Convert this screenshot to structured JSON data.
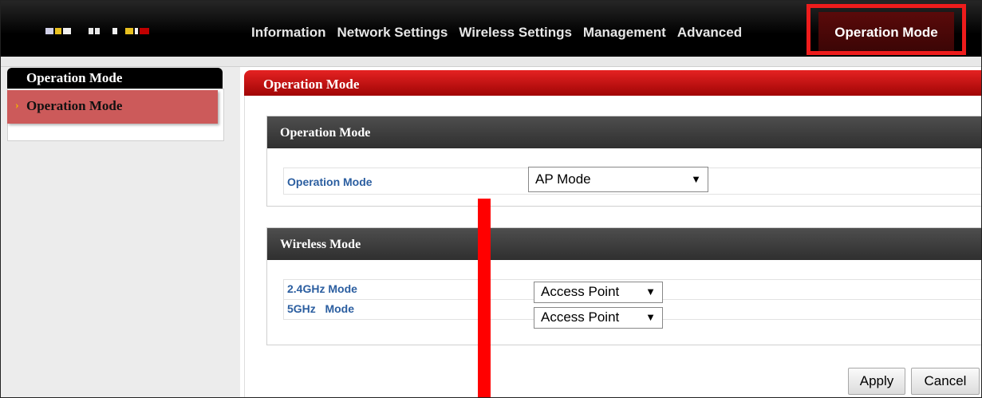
{
  "nav": {
    "items": [
      "Information",
      "Network Settings",
      "Wireless Settings",
      "Management",
      "Advanced"
    ],
    "active": "Operation Mode"
  },
  "sidebar": {
    "header": "Operation Mode",
    "items": [
      {
        "label": "Operation Mode",
        "selected": true
      }
    ]
  },
  "main": {
    "title": "Operation Mode",
    "operation_section": {
      "title": "Operation Mode",
      "label": "Operation Mode",
      "value": "AP Mode"
    },
    "wireless_section": {
      "title": "Wireless Mode",
      "rows": [
        {
          "label": "2.4GHz Mode",
          "value": "Access Point"
        },
        {
          "label": "5GHz   Mode",
          "value": "Access Point"
        }
      ]
    },
    "buttons": {
      "apply": "Apply",
      "cancel": "Cancel"
    }
  },
  "colors": {
    "accent": "#cc0000",
    "highlight": "#ee1c1c",
    "label": "#2b5ea0"
  }
}
